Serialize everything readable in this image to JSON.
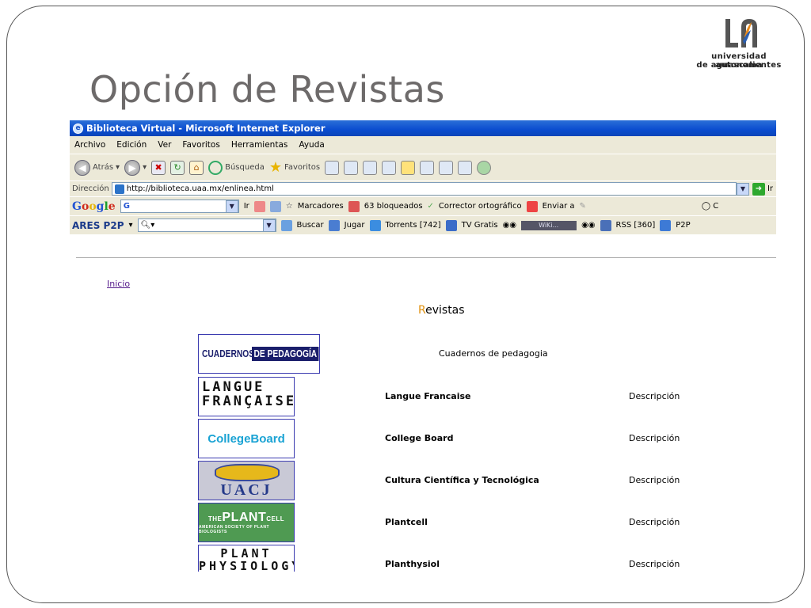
{
  "slide": {
    "title": "Opción de Revistas",
    "logo_line1": "universidad autonoma",
    "logo_line2": "de aguascalientes"
  },
  "browser": {
    "window_title": "Biblioteca Virtual - Microsoft Internet Explorer",
    "menu": [
      "Archivo",
      "Edición",
      "Ver",
      "Favoritos",
      "Herramientas",
      "Ayuda"
    ],
    "toolbar": {
      "back": "Atrás",
      "search": "Búsqueda",
      "favorites": "Favoritos"
    },
    "address": {
      "label": "Dirección",
      "url": "http://biblioteca.uaa.mx/enlinea.html",
      "go": "Ir"
    },
    "google_bar": {
      "logo": "Google",
      "search_icon": "G",
      "go": "Ir",
      "bookmarks": "Marcadores",
      "blocked": "63 bloqueados",
      "spellcheck": "Corrector ortográfico",
      "send": "Enviar a"
    },
    "ares_bar": {
      "logo": "ARES P2P",
      "search": "Buscar",
      "play": "Jugar",
      "torrents": "Torrents [742]",
      "tv": "TV Gratis",
      "media_label": "WiKi...",
      "rss": "RSS [360]",
      "p2p": "P2P"
    }
  },
  "page": {
    "home_link": "Inicio",
    "heading_first": "R",
    "heading_rest": "evistas",
    "header_journal": "Cuadernos de pedagogia",
    "journals": [
      {
        "name": "Langue Francaise",
        "desc": "Descripción"
      },
      {
        "name": "College Board",
        "desc": "Descripción"
      },
      {
        "name": "Cultura Científica y Tecnológica",
        "desc": "Descripción"
      },
      {
        "name": "Plantcell",
        "desc": "Descripción"
      },
      {
        "name": "Planthysiol",
        "desc": "Descripción"
      }
    ],
    "covers": {
      "cuadernos_a": "CUADERNOS",
      "cuadernos_b": "DE PEDAGOGÍA",
      "langue_1": "LANGUE",
      "langue_2": "FRANÇAISE",
      "college": "CollegeBoard",
      "uacj": "UACJ",
      "plant_pre": "THE",
      "plant_main": "PLANT",
      "plant_post": "CELL",
      "plant_sub": "AMERICAN SOCIETY OF PLANT BIOLOGISTS",
      "physio_1": "PLANT",
      "physio_2": "PHYSIOLOGY"
    }
  }
}
